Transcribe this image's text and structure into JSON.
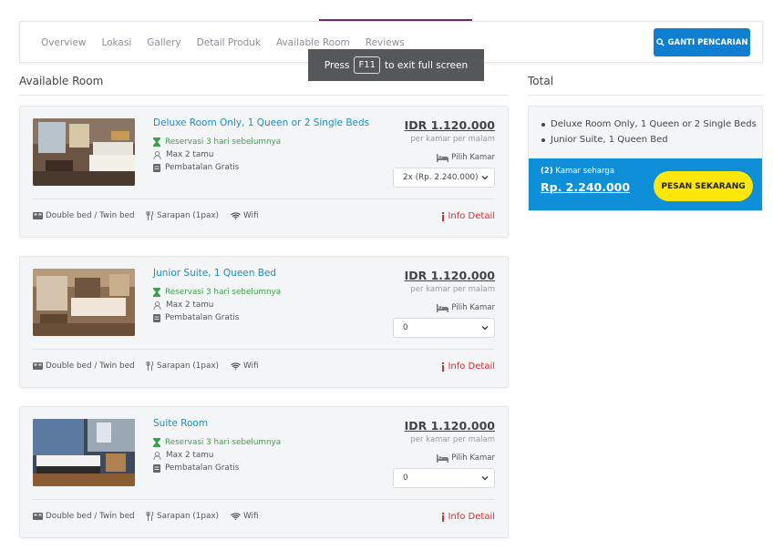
{
  "nav": {
    "links": [
      "Overview",
      "Lokasi",
      "Gallery",
      "Detail Produk",
      "Available Room",
      "Reviews"
    ],
    "search_button": "GANTI PENCARIAN"
  },
  "fullscreen_toast": {
    "press": "Press",
    "key": "F11",
    "suffix": "to exit full screen"
  },
  "available_title": "Available Room",
  "total_title": "Total",
  "rooms": [
    {
      "name": "Deluxe Room Only, 1 Queen or 2 Single Beds",
      "reservation": "Reservasi 3 hari sebelumnya",
      "guests": "Max 2 tamu",
      "cancellation": "Pembatalan Gratis",
      "price": "IDR 1.120.000",
      "per": "per kamar per malam",
      "pick": "Pilih Kamar",
      "selected": "2x (Rp. 2.240.000)",
      "bed": "Double bed / Twin bed",
      "breakfast": "Sarapan (1pax)",
      "wifi": "Wifi",
      "info": "Info Detail"
    },
    {
      "name": "Junior Suite, 1 Queen Bed",
      "reservation": "Reservasi 3 hari sebelumnya",
      "guests": "Max 2 tamu",
      "cancellation": "Pembatalan Gratis",
      "price": "IDR 1.120.000",
      "per": "per kamar per malam",
      "pick": "Pilih Kamar",
      "selected": "0",
      "bed": "Double bed / Twin bed",
      "breakfast": "Sarapan (1pax)",
      "wifi": "Wifi",
      "info": "Info Detail"
    },
    {
      "name": "Suite Room",
      "reservation": "Reservasi 3 hari sebelumnya",
      "guests": "Max 2 tamu",
      "cancellation": "Pembatalan Gratis",
      "price": "IDR 1.120.000",
      "per": "per kamar per malam",
      "pick": "Pilih Kamar",
      "selected": "0",
      "bed": "Double bed / Twin bed",
      "breakfast": "Sarapan (1pax)",
      "wifi": "Wifi",
      "info": "Info Detail"
    }
  ],
  "total": {
    "items": [
      "Deluxe Room Only, 1 Queen or 2 Single Beds",
      "Junior Suite, 1 Queen Bed"
    ],
    "count": "(2)",
    "count_suffix": "Kamar seharga",
    "price": "Rp. 2.240.000",
    "order_button": "PESAN SEKARANG"
  },
  "colors": {
    "accent": "#0f7fd1",
    "link": "#1d8bc9",
    "green": "#3aa14a",
    "red": "#d92b2b",
    "yellow": "#fde60a"
  },
  "icons": {
    "search": "search-icon",
    "reservation": "hourglass-icon",
    "guests": "user-icon",
    "cancellation": "document-icon",
    "bed": "bed-icon",
    "breakfast": "utensils-icon",
    "wifi": "wifi-icon",
    "info": "info-icon"
  }
}
